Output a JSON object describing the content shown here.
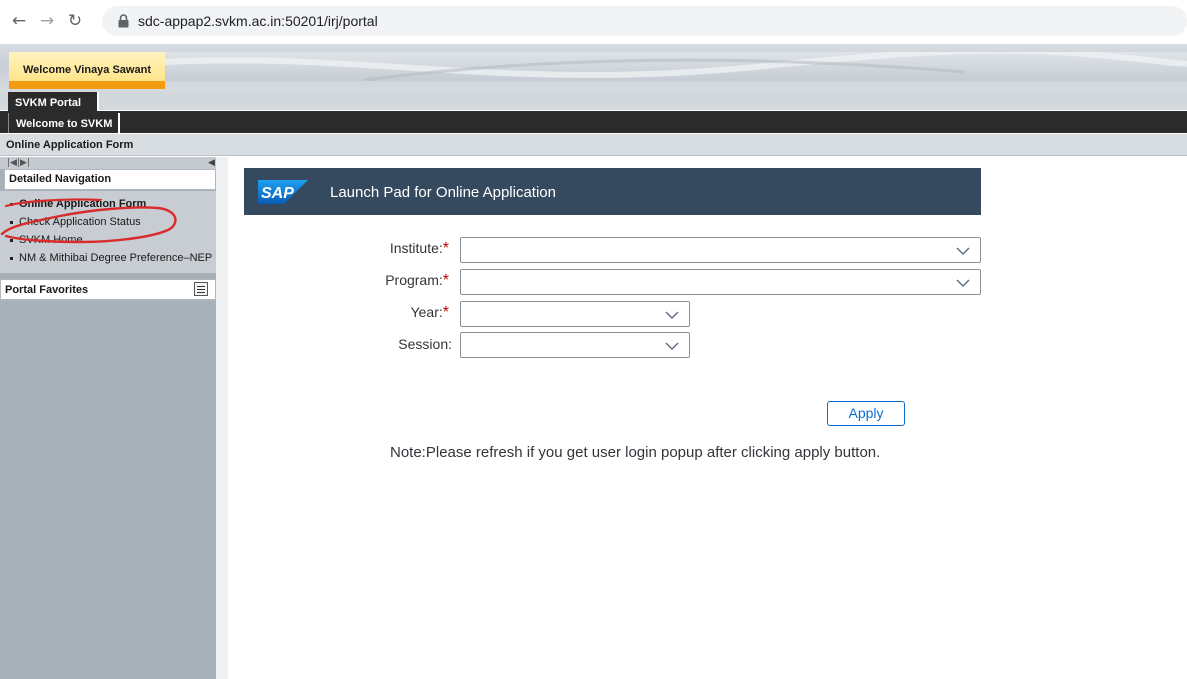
{
  "browser": {
    "url": "sdc-appap2.svkm.ac.in:50201/irj/portal"
  },
  "header": {
    "welcome_text": "Welcome Vinaya Sawant"
  },
  "tabs": {
    "portal": "SVKM Portal",
    "welcome": "Welcome to SVKM"
  },
  "breadcrumb": "Online Application Form",
  "detailed_nav": {
    "title": "Detailed Navigation",
    "items": [
      {
        "label": "Online Application Form",
        "selected": true
      },
      {
        "label": "Check Application Status",
        "selected": false
      },
      {
        "label": "SVKM Home",
        "selected": false
      },
      {
        "label": "NM & Mithibai Degree Preference–NEP",
        "selected": false
      }
    ]
  },
  "portal_favorites": {
    "title": "Portal Favorites"
  },
  "launchpad": {
    "logo": "SAP",
    "title": "Launch Pad for Online Application"
  },
  "form": {
    "fields": [
      {
        "label": "Institute:",
        "required": true,
        "value": ""
      },
      {
        "label": "Program:",
        "required": true,
        "value": ""
      },
      {
        "label": "Year:",
        "required": true,
        "value": ""
      },
      {
        "label": "Session:",
        "required": false,
        "value": ""
      }
    ],
    "apply_label": "Apply",
    "note": "Note:Please refresh if you get user login popup after clicking apply button."
  },
  "colors": {
    "sap_bar": "#354a5f",
    "required": "#bb0000",
    "apply_border": "#0a6ed1",
    "annotation": "#d92b2b"
  }
}
